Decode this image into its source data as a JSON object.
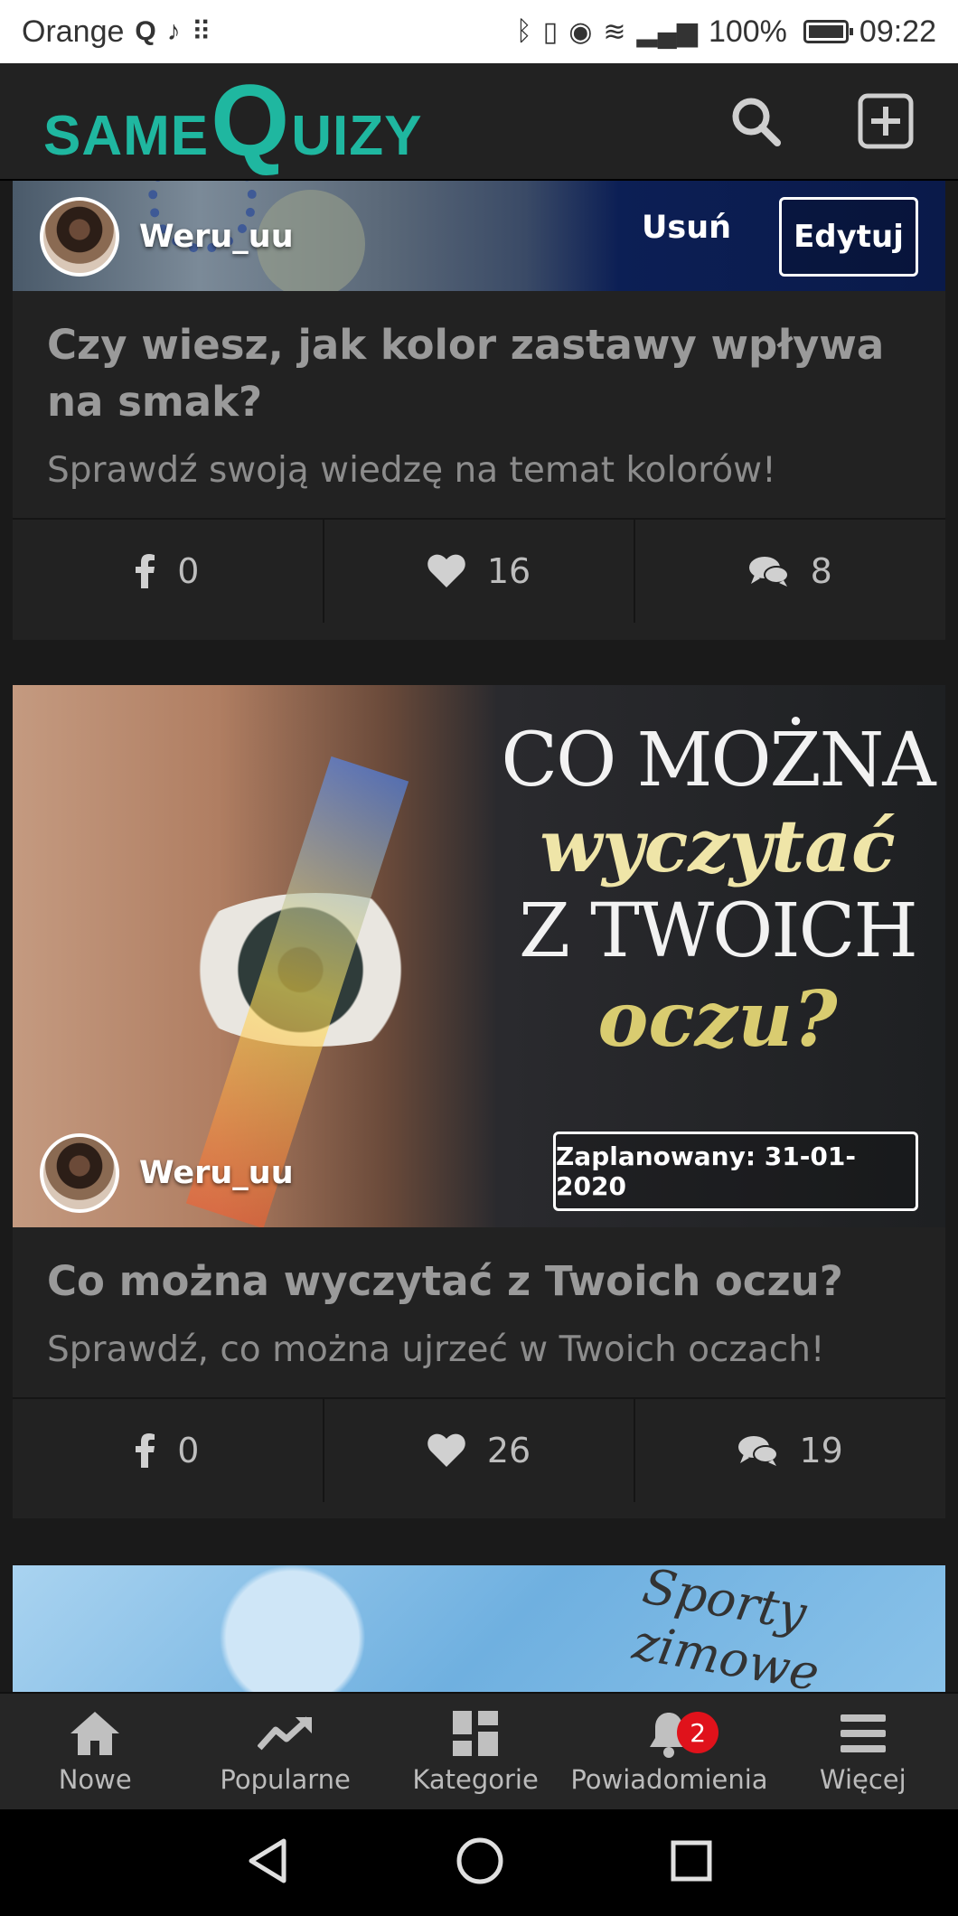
{
  "status_bar": {
    "carrier": "Orange",
    "battery": "100%",
    "time": "09:22"
  },
  "header": {
    "logo_same": "SAME",
    "logo_q": "Q",
    "logo_uizy": "UIZY",
    "brand_color": "#1fb7a0"
  },
  "cards": [
    {
      "author": "Weru_uu",
      "delete_label": "Usuń",
      "edit_label": "Edytuj",
      "title": "Czy wiesz, jak kolor zastawy wpływa na smak?",
      "subtitle": "Sprawdź swoją wiedzę na temat kolorów!",
      "facebook": "0",
      "likes": "16",
      "comments": "8"
    },
    {
      "author": "Weru_uu",
      "scheduled": "Zaplanowany: 31-01-2020",
      "banner_line1": "CO MOŻNA",
      "banner_line2": "wyczytać",
      "banner_line3": "Z TWOICH",
      "banner_line4": "oczu?",
      "title": "Co można wyczytać z Twoich oczu?",
      "subtitle": "Sprawdź, co można ujrzeć w Twoich oczach!",
      "facebook": "0",
      "likes": "26",
      "comments": "19"
    },
    {
      "banner_script": "Sporty zimowe"
    }
  ],
  "bottom_nav": {
    "items": [
      {
        "label": "Nowe",
        "icon": "home-icon"
      },
      {
        "label": "Popularne",
        "icon": "trending-icon"
      },
      {
        "label": "Kategorie",
        "icon": "grid-icon"
      },
      {
        "label": "Powiadomienia",
        "icon": "bell-icon"
      },
      {
        "label": "Więcej",
        "icon": "menu-icon"
      }
    ],
    "notification_count": "2"
  }
}
